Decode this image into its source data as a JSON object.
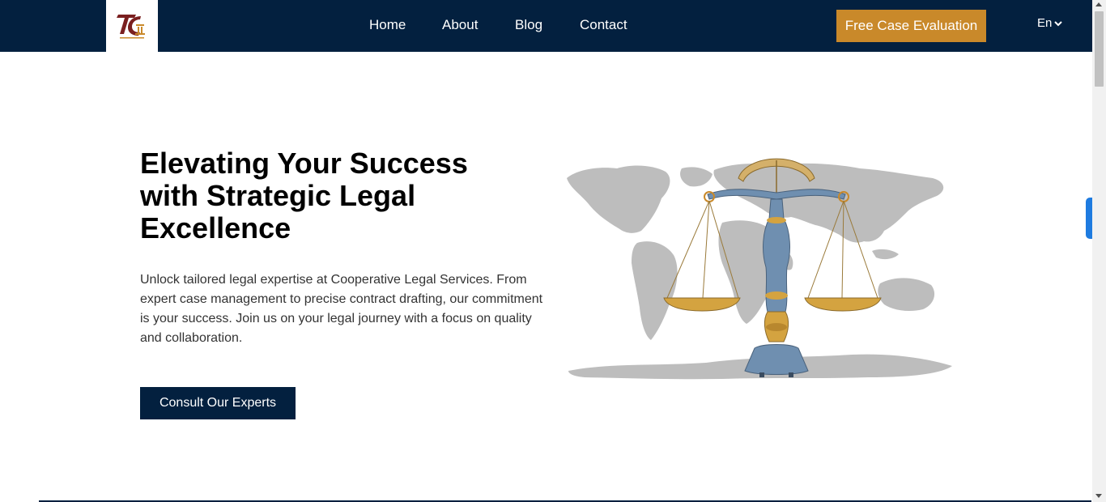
{
  "nav": {
    "links": [
      "Home",
      "About",
      "Blog",
      "Contact"
    ],
    "cta_label": "Free Case Evaluation",
    "language": "En"
  },
  "hero": {
    "title_line1": "Elevating Your Success",
    "title_line2": "with Strategic Legal",
    "title_line3": "Excellence",
    "description": "Unlock tailored legal expertise at Cooperative Legal Services. From expert case management to precise contract drafting, our commitment is your success. Join us on your legal journey with a focus on quality and collaboration.",
    "button_label": "Consult Our Experts"
  },
  "colors": {
    "navbar": "#03203f",
    "accent": "#c9892a",
    "side_tab": "#1e7be0"
  }
}
